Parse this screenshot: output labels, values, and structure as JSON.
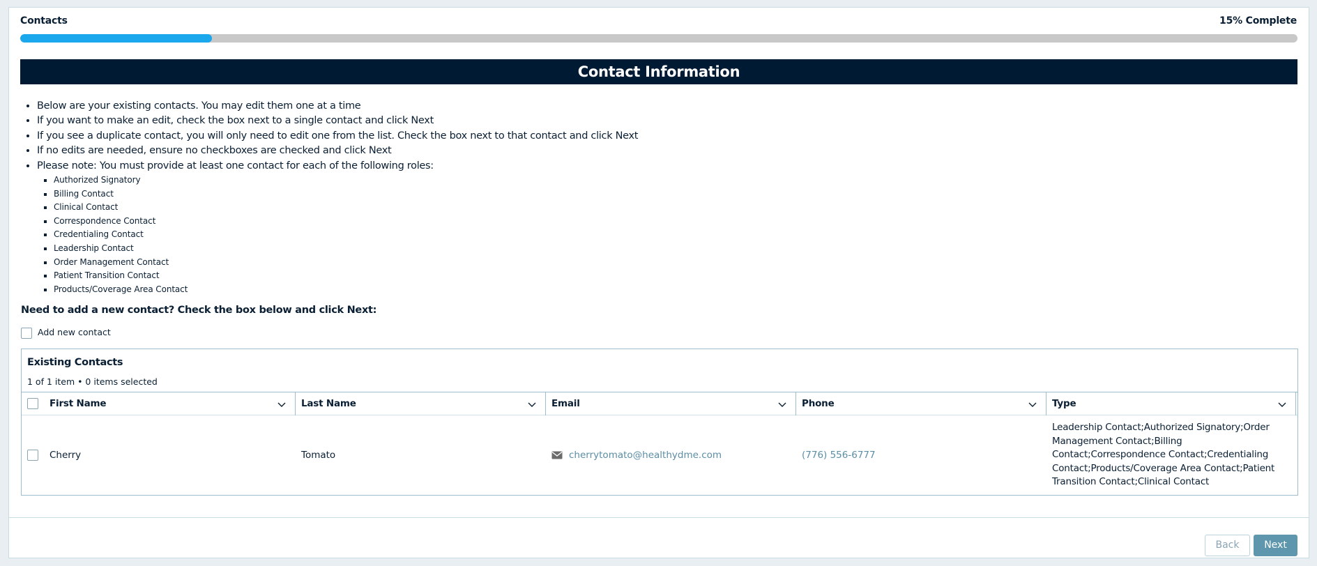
{
  "header": {
    "section_label": "Contacts",
    "progress_label": "15% Complete",
    "progress_fraction": 0.15
  },
  "banner": {
    "title": "Contact Information"
  },
  "instructions": {
    "items": [
      "Below are your existing contacts. You may edit them one at a time",
      "If you want to make an edit, check the box next to a single contact and click Next",
      "If you see a duplicate contact, you will only need to edit one from the list. Check the box next to that contact and click Next",
      "If no edits are needed, ensure no checkboxes are checked and click Next",
      "Please note: You must provide at least one contact for each of the following roles:"
    ],
    "roles": [
      "Authorized Signatory",
      "Billing Contact",
      "Clinical Contact",
      "Correspondence Contact",
      "Credentialing Contact",
      "Leadership Contact",
      "Order Management Contact",
      "Patient Transition Contact",
      "Products/Coverage Area Contact"
    ]
  },
  "new_contact": {
    "prompt": "Need to add a new contact? Check the box below and click Next:",
    "checkbox_label": "Add new contact",
    "checked": false
  },
  "grid": {
    "title": "Existing Contacts",
    "count_text": "1 of 1 item • 0 items selected",
    "columns": [
      "First Name",
      "Last Name",
      "Email",
      "Phone",
      "Type"
    ],
    "rows": [
      {
        "first_name": "Cherry",
        "last_name": "Tomato",
        "email": "cherrytomato@healthydme.com",
        "phone": "(776) 556-6777",
        "type": "Leadership Contact;Authorized Signatory;Order Management Contact;Billing Contact;Correspondence Contact;Credentialing Contact;Products/Coverage Area Contact;Patient Transition Contact;Clinical Contact"
      }
    ]
  },
  "footer": {
    "back_label": "Back",
    "next_label": "Next"
  },
  "colors": {
    "banner_bg": "#001a33",
    "progress_fill": "#1aa7ec",
    "link": "#5a8ea6",
    "primary_button": "#5e97ad"
  },
  "icons": {
    "email": "envelope-icon",
    "sort": "chevron-down-icon"
  }
}
